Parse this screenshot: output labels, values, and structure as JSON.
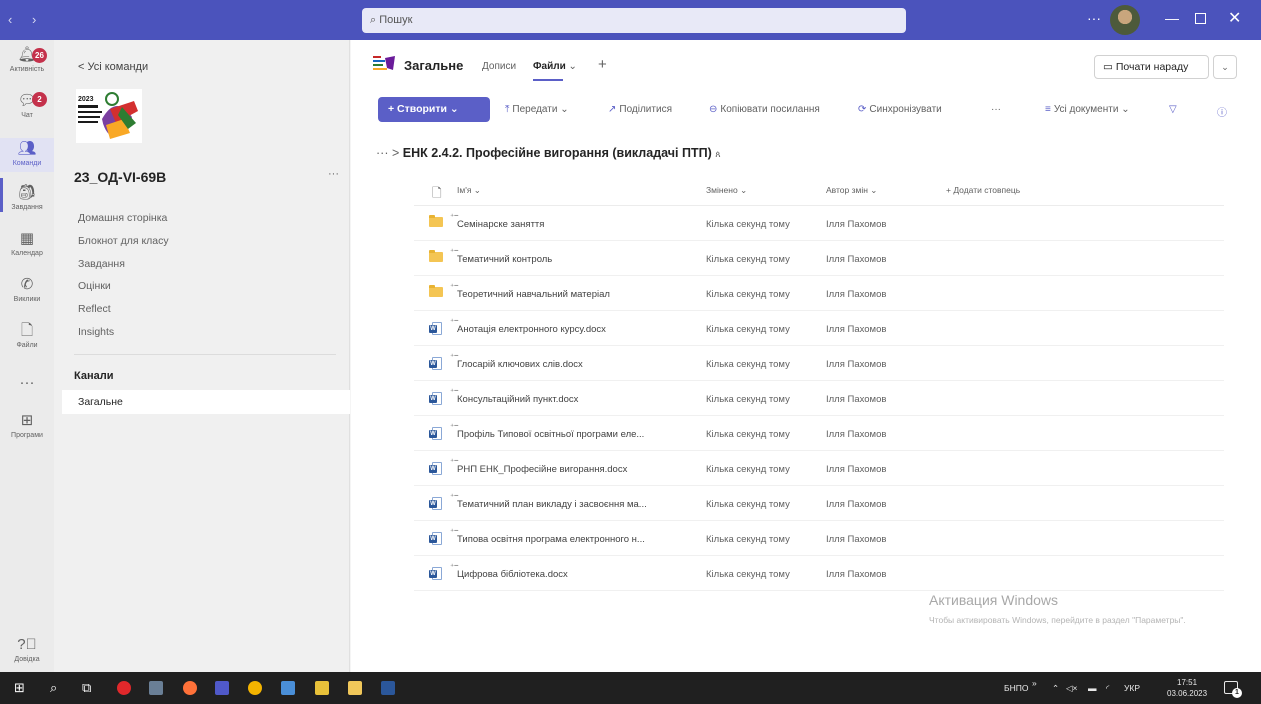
{
  "titlebar": {
    "nav": "‹ ›",
    "search_placeholder": "Пошук",
    "more": "···",
    "minimize": "—",
    "close": "✕"
  },
  "appbar": {
    "items": [
      {
        "label": "Активність",
        "icon": "bell-icon",
        "badge": "26"
      },
      {
        "label": "Чат",
        "icon": "chat-icon",
        "badge": "2"
      },
      {
        "label": "Команди",
        "icon": "teams-icon"
      },
      {
        "label": "Завдання",
        "icon": "assignments-icon"
      },
      {
        "label": "Календар",
        "icon": "calendar-icon"
      },
      {
        "label": "Виклики",
        "icon": "phone-icon"
      },
      {
        "label": "Файли",
        "icon": "file-icon"
      },
      {
        "label": "···",
        "icon": "more-icon"
      },
      {
        "label": "Програми",
        "icon": "apps-icon"
      }
    ],
    "help": "Довідка"
  },
  "leftpane": {
    "back": "< Усі команди",
    "team_name": "23_ОД-VI-69В",
    "more": "···",
    "links": [
      "Домашня сторінка",
      "Блокнот для класу",
      "Завдання",
      "Оцінки",
      "Reflect",
      "Insights"
    ],
    "channels_heading": "Канали",
    "channel_selected": "Загальне"
  },
  "main": {
    "channel_title": "Загальне",
    "tabs": [
      "Дописи",
      "Файли",
      "+"
    ],
    "tab_chevron": "⌄",
    "meet_button": "Почати нараду",
    "meet_drop": "⌄",
    "toolbar": {
      "create": "+ Створити ⌄",
      "upload": "Передати ⌄",
      "share": "Поділитися",
      "copy_link": "Копіювати посилання",
      "sync": "Синхронізувати",
      "more": "···",
      "view": "Усі документи ⌄"
    },
    "breadcrumb_dots": "··· >",
    "breadcrumb": "ЕНК 2.4.2. Професійне вигорання (викладачі ПТП)",
    "columns": {
      "name": "Ім'я ⌄",
      "modified": "Змінено ⌄",
      "author": "Автор змін ⌄",
      "add": "+ Додати стовпець"
    },
    "files": [
      {
        "type": "folder",
        "name": "Семінарске заняття",
        "modified": "Кілька секунд тому",
        "author": "Ілля Пахомов"
      },
      {
        "type": "folder",
        "name": "Тематичний контроль",
        "modified": "Кілька секунд тому",
        "author": "Ілля Пахомов"
      },
      {
        "type": "folder",
        "name": "Теоретичний навчальний матеріал",
        "modified": "Кілька секунд тому",
        "author": "Ілля Пахомов"
      },
      {
        "type": "docx",
        "name": "Анотація електронного курсу.docx",
        "modified": "Кілька секунд тому",
        "author": "Ілля Пахомов"
      },
      {
        "type": "docx",
        "name": "Глосарій ключових слів.docx",
        "modified": "Кілька секунд тому",
        "author": "Ілля Пахомов"
      },
      {
        "type": "docx",
        "name": "Консультаційний пункт.docx",
        "modified": "Кілька секунд тому",
        "author": "Ілля Пахомов"
      },
      {
        "type": "docx",
        "name": "Профіль Типової освітньої програми еле...",
        "modified": "Кілька секунд тому",
        "author": "Ілля Пахомов"
      },
      {
        "type": "docx",
        "name": "РНП ЕНК_Професійне вигорання.docx",
        "modified": "Кілька секунд тому",
        "author": "Ілля Пахомов"
      },
      {
        "type": "docx",
        "name": "Тематичний план викладу і засвоєння ма...",
        "modified": "Кілька секунд тому",
        "author": "Ілля Пахомов"
      },
      {
        "type": "docx",
        "name": "Типова освітня програма електронного н...",
        "modified": "Кілька секунд тому",
        "author": "Ілля Пахомов"
      },
      {
        "type": "docx",
        "name": "Цифрова бібліотека.docx",
        "modified": "Кілька секунд тому",
        "author": "Ілля Пахомов"
      }
    ],
    "watermark_title": "Активация Windows",
    "watermark_text": "Чтобы активировать Windows, перейдите в раздел \"Параметры\"."
  },
  "taskbar": {
    "lang": "БНПО",
    "tray_chevron": "»",
    "input_lang": "УКР",
    "time": "17:51",
    "date": "03.06.2023",
    "notifications": "1"
  },
  "colors": {
    "accent": "#5b5fc7",
    "titlebar": "#4b53bc",
    "taskbar": "#202020"
  }
}
